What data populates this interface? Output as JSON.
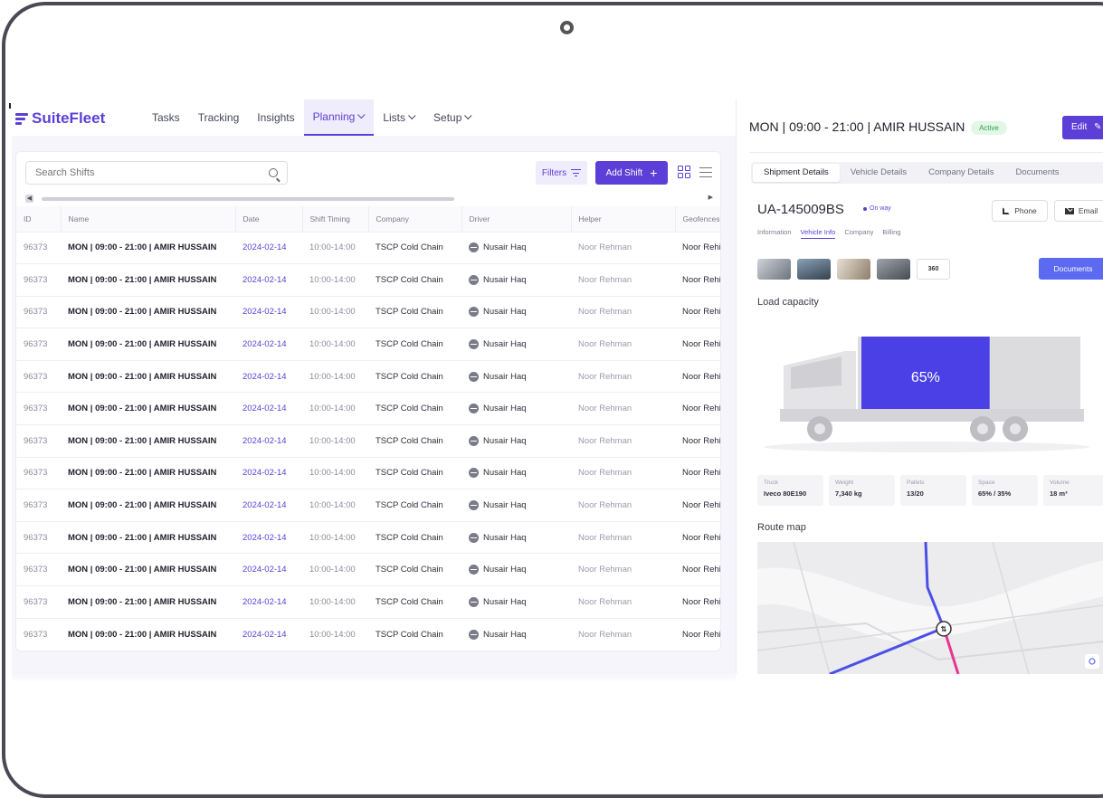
{
  "app": {
    "name": "SuiteFleet"
  },
  "nav": {
    "items": [
      {
        "label": "Tasks",
        "dropdown": false,
        "active": false
      },
      {
        "label": "Tracking",
        "dropdown": false,
        "active": false
      },
      {
        "label": "Insights",
        "dropdown": false,
        "active": false
      },
      {
        "label": "Planning",
        "dropdown": true,
        "active": true
      },
      {
        "label": "Lists",
        "dropdown": true,
        "active": false
      },
      {
        "label": "Setup",
        "dropdown": true,
        "active": false
      }
    ]
  },
  "toolbar": {
    "search_placeholder": "Search Shifts",
    "filters_label": "Filters",
    "add_shift_label": "Add Shift"
  },
  "table": {
    "columns": [
      "ID",
      "Name",
      "Date",
      "Shift Timing",
      "Company",
      "Driver",
      "Helper",
      "Geofences"
    ],
    "rows": [
      {
        "id": "96373",
        "name": "MON | 09:00 - 21:00 | AMIR HUSSAIN",
        "date": "2024-02-14",
        "timing": "10:00-14:00",
        "company": "TSCP Cold Chain",
        "driver": "Nusair Haq",
        "helper": "Noor Rehman",
        "geofences": "Noor Rehi"
      },
      {
        "id": "96373",
        "name": "MON | 09:00 - 21:00 | AMIR HUSSAIN",
        "date": "2024-02-14",
        "timing": "10:00-14:00",
        "company": "TSCP Cold Chain",
        "driver": "Nusair Haq",
        "helper": "Noor Rehman",
        "geofences": "Noor Rehi"
      },
      {
        "id": "96373",
        "name": "MON | 09:00 - 21:00 | AMIR HUSSAIN",
        "date": "2024-02-14",
        "timing": "10:00-14:00",
        "company": "TSCP Cold Chain",
        "driver": "Nusair Haq",
        "helper": "Noor Rehman",
        "geofences": "Noor Rehi"
      },
      {
        "id": "96373",
        "name": "MON | 09:00 - 21:00 | AMIR HUSSAIN",
        "date": "2024-02-14",
        "timing": "10:00-14:00",
        "company": "TSCP Cold Chain",
        "driver": "Nusair Haq",
        "helper": "Noor Rehman",
        "geofences": "Noor Rehi"
      },
      {
        "id": "96373",
        "name": "MON | 09:00 - 21:00 | AMIR HUSSAIN",
        "date": "2024-02-14",
        "timing": "10:00-14:00",
        "company": "TSCP Cold Chain",
        "driver": "Nusair Haq",
        "helper": "Noor Rehman",
        "geofences": "Noor Rehi"
      },
      {
        "id": "96373",
        "name": "MON | 09:00 - 21:00 | AMIR HUSSAIN",
        "date": "2024-02-14",
        "timing": "10:00-14:00",
        "company": "TSCP Cold Chain",
        "driver": "Nusair Haq",
        "helper": "Noor Rehman",
        "geofences": "Noor Rehi"
      },
      {
        "id": "96373",
        "name": "MON | 09:00 - 21:00 | AMIR HUSSAIN",
        "date": "2024-02-14",
        "timing": "10:00-14:00",
        "company": "TSCP Cold Chain",
        "driver": "Nusair Haq",
        "helper": "Noor Rehman",
        "geofences": "Noor Rehi"
      },
      {
        "id": "96373",
        "name": "MON | 09:00 - 21:00 | AMIR HUSSAIN",
        "date": "2024-02-14",
        "timing": "10:00-14:00",
        "company": "TSCP Cold Chain",
        "driver": "Nusair Haq",
        "helper": "Noor Rehman",
        "geofences": "Noor Rehi"
      },
      {
        "id": "96373",
        "name": "MON | 09:00 - 21:00 | AMIR HUSSAIN",
        "date": "2024-02-14",
        "timing": "10:00-14:00",
        "company": "TSCP Cold Chain",
        "driver": "Nusair Haq",
        "helper": "Noor Rehman",
        "geofences": "Noor Rehi"
      },
      {
        "id": "96373",
        "name": "MON | 09:00 - 21:00 | AMIR HUSSAIN",
        "date": "2024-02-14",
        "timing": "10:00-14:00",
        "company": "TSCP Cold Chain",
        "driver": "Nusair Haq",
        "helper": "Noor Rehman",
        "geofences": "Noor Rehi"
      },
      {
        "id": "96373",
        "name": "MON | 09:00 - 21:00 | AMIR HUSSAIN",
        "date": "2024-02-14",
        "timing": "10:00-14:00",
        "company": "TSCP Cold Chain",
        "driver": "Nusair Haq",
        "helper": "Noor Rehman",
        "geofences": "Noor Rehi"
      },
      {
        "id": "96373",
        "name": "MON | 09:00 - 21:00 | AMIR HUSSAIN",
        "date": "2024-02-14",
        "timing": "10:00-14:00",
        "company": "TSCP Cold Chain",
        "driver": "Nusair Haq",
        "helper": "Noor Rehman",
        "geofences": "Noor Rehi"
      },
      {
        "id": "96373",
        "name": "MON | 09:00 - 21:00 | AMIR HUSSAIN",
        "date": "2024-02-14",
        "timing": "10:00-14:00",
        "company": "TSCP Cold Chain",
        "driver": "Nusair Haq",
        "helper": "Noor Rehman",
        "geofences": "Noor Rehi"
      }
    ]
  },
  "detail": {
    "title": "MON | 09:00 - 21:00 | AMIR HUSSAIN",
    "status": "Active",
    "edit_label": "Edit",
    "tabs": [
      "Shipment Details",
      "Vehicle Details",
      "Company Details",
      "Documents"
    ],
    "active_tab": "Shipment Details",
    "vehicle_id": "UA-145009BS",
    "vehicle_status": "On way",
    "phone_label": "Phone",
    "email_label": "Email",
    "subtabs": [
      "Information",
      "Vehicle Info",
      "Company",
      "Billing"
    ],
    "active_subtab": "Vehicle Info",
    "thumb_360_label": "360",
    "documents_label": "Documents",
    "load_capacity_label": "Load capacity",
    "load_percent_label": "65%",
    "load_fraction": 0.65,
    "stats": [
      {
        "label": "Truck",
        "value": "Iveco 80E190"
      },
      {
        "label": "Weight",
        "value": "7,340 kg"
      },
      {
        "label": "Pallets",
        "value": "13/20"
      },
      {
        "label": "Space",
        "value": "65% / 35%"
      },
      {
        "label": "Volume",
        "value": "18 m³"
      }
    ],
    "route_map_label": "Route map"
  },
  "colors": {
    "accent": "#5b3fd6",
    "load_fill": "#4b3fe6",
    "documents_button": "#5b6af0",
    "active_badge_bg": "#e3f7e6",
    "active_badge_text": "#2f9e48",
    "route_blue": "#4a50e6",
    "route_pink": "#e8358f"
  }
}
